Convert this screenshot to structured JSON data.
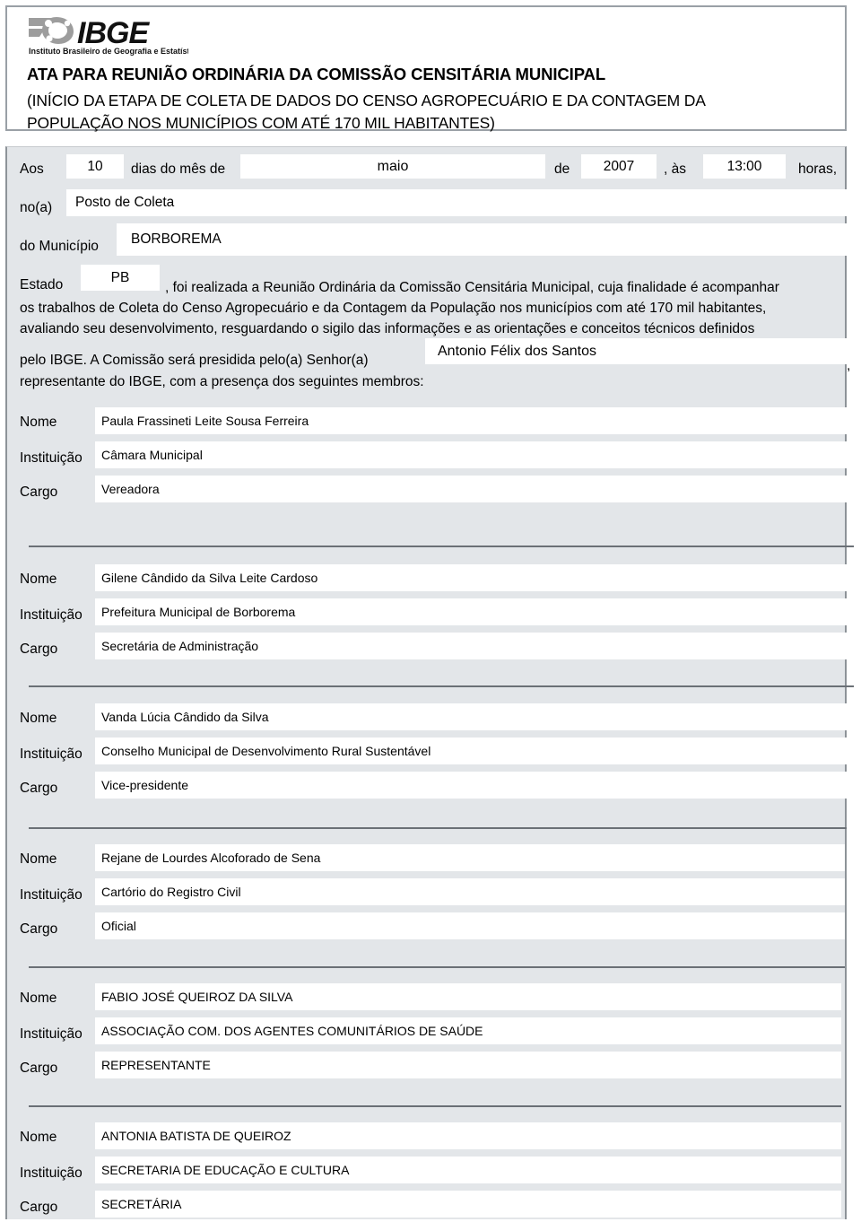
{
  "header": {
    "logo_name": "ibge-logo",
    "logo_text": "IBGE",
    "logo_subtitle": "Instituto Brasileiro de Geografia e Estatística",
    "title": "ATA PARA REUNIÃO ORDINÁRIA DA COMISSÃO CENSITÁRIA MUNICIPAL",
    "subtitle_line1": "(INÍCIO DA ETAPA DE COLETA DE DADOS DO CENSO AGROPECUÁRIO E DA CONTAGEM DA",
    "subtitle_line2": "POPULAÇÃO NOS MUNICÍPIOS COM ATÉ 170 MIL HABITANTES)"
  },
  "form": {
    "label_aos": "Aos",
    "dia_value": "10",
    "label_dias_mes": "dias do mês de",
    "mes_value": "maio",
    "label_de": "de",
    "ano_value": "2007",
    "label_as": ", às",
    "hora_value": "13:00",
    "label_horas": "horas,",
    "label_noa": "no(a)",
    "local_value": "Posto de Coleta",
    "label_municipio": "do Município",
    "municipio_value": "BORBOREMA",
    "label_estado": "Estado",
    "estado_value": "PB",
    "presidente_value": "Antonio Félix dos Santos",
    "paragraph_line1": ",  foi realizada a Reunião Ordinária da Comissão Censitária Municipal, cuja finalidade é acompanhar",
    "paragraph_line2": "os trabalhos de Coleta do Censo Agropecuário e da Contagem da População nos municípios com até 170 mil habitantes,",
    "paragraph_line3": "avaliando seu desenvolvimento, resguardando o sigilo das informações e as orientações e conceitos técnicos definidos",
    "paragraph_line4": "pelo IBGE. A Comissão será presidida pelo(a) Senhor(a)",
    "paragraph_line5": "representante do IBGE, com a presença dos seguintes membros:",
    "paragraph_trailing_comma": ","
  },
  "member_labels": {
    "nome": "Nome",
    "instituicao": "Instituição",
    "cargo": "Cargo"
  },
  "members": [
    {
      "nome": "Paula Frassineti Leite Sousa Ferreira",
      "instituicao": "Câmara Municipal",
      "cargo": "Vereadora"
    },
    {
      "nome": "Gilene Cândido da Silva Leite Cardoso",
      "instituicao": "Prefeitura Municipal de Borborema",
      "cargo": "Secretária de Administração"
    },
    {
      "nome": "Vanda Lúcia Cândido da Silva",
      "instituicao": "Conselho Municipal de Desenvolvimento Rural Sustentável",
      "cargo": "Vice-presidente"
    },
    {
      "nome": "Rejane de Lourdes Alcoforado de Sena",
      "instituicao": "Cartório do Registro Civil",
      "cargo": "Oficial"
    },
    {
      "nome": "FABIO JOSÉ QUEIROZ DA SILVA",
      "instituicao": "ASSOCIAÇÃO COM. DOS AGENTES COMUNITÁRIOS DE SAÚDE",
      "cargo": "REPRESENTANTE"
    },
    {
      "nome": "ANTONIA BATISTA DE QUEIROZ",
      "instituicao": "SECRETARIA DE EDUCAÇÃO E CULTURA",
      "cargo": "SECRETÁRIA"
    }
  ],
  "colors": {
    "page_background": "#ffffff",
    "form_background": "#e3e6e9",
    "field_background": "#ffffff",
    "border": "#8d9398",
    "separator": "#6b7076",
    "text": "#000000",
    "logo_gray": "#9d9d9d"
  }
}
